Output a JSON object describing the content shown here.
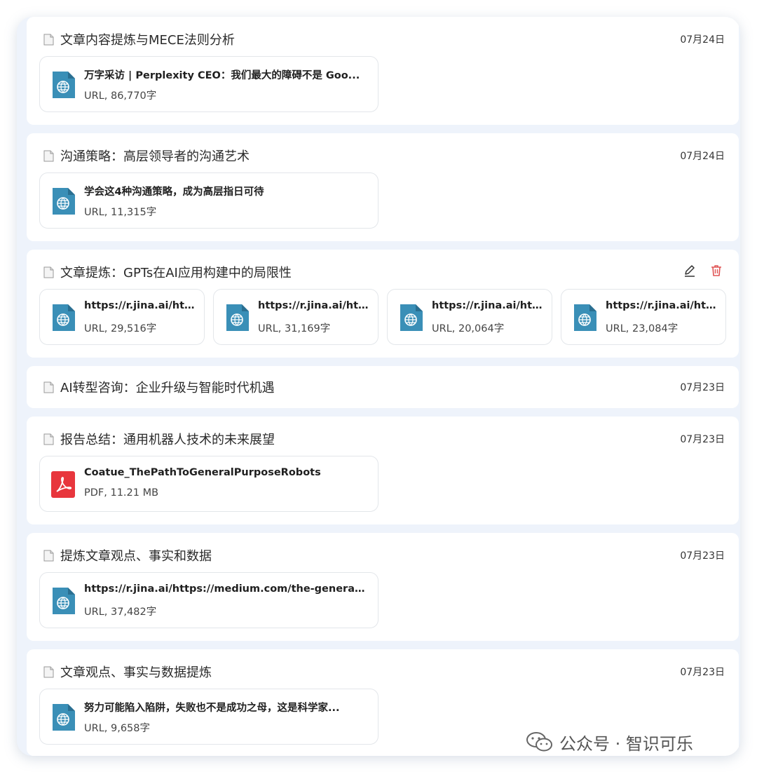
{
  "cards": [
    {
      "title": "文章内容提炼与MECE法则分析",
      "date": "07月24日",
      "attachments": [
        {
          "type": "url",
          "name": "万字采访 | Perplexity CEO：我们最大的障碍不是 Goo...",
          "meta": "URL, 86,770字"
        }
      ]
    },
    {
      "title": "沟通策略：高层领导者的沟通艺术",
      "date": "07月24日",
      "attachments": [
        {
          "type": "url",
          "name": "学会这4种沟通策略，成为高层指日可待",
          "meta": "URL, 11,315字"
        }
      ]
    },
    {
      "title": "文章提炼：GPTs在AI应用构建中的局限性",
      "date": "",
      "actions": [
        "edit-icon",
        "trash-icon"
      ],
      "attachments": [
        {
          "type": "url",
          "name": "https://r.jina.ai/htt...",
          "meta": "URL, 29,516字"
        },
        {
          "type": "url",
          "name": "https://r.jina.ai/htt...",
          "meta": "URL, 31,169字"
        },
        {
          "type": "url",
          "name": "https://r.jina.ai/htt...",
          "meta": "URL, 20,064字"
        },
        {
          "type": "url",
          "name": "https://r.jina.ai/htt...",
          "meta": "URL, 23,084字"
        }
      ]
    },
    {
      "title": "AI转型咨询：企业升级与智能时代机遇",
      "date": "07月23日",
      "attachments": []
    },
    {
      "title": "报告总结：通用机器人技术的未来展望",
      "date": "07月23日",
      "attachments": [
        {
          "type": "pdf",
          "name": "Coatue_ThePathToGeneralPurposeRobots",
          "meta": "PDF, 11.21 MB"
        }
      ]
    },
    {
      "title": "提炼文章观点、事实和数据",
      "date": "07月23日",
      "attachments": [
        {
          "type": "url",
          "name": "https://r.jina.ai/https://medium.com/the-generato...",
          "meta": "URL, 37,482字"
        }
      ]
    },
    {
      "title": "文章观点、事实与数据提炼",
      "date": "07月23日",
      "attachments": [
        {
          "type": "url",
          "name": "努力可能陷入陷阱，失败也不是成功之母，这是科学家...",
          "meta": "URL, 9,658字"
        }
      ]
    }
  ],
  "watermark": {
    "text": "公众号 · 智识可乐",
    "icon": "wechat-icon"
  },
  "colors": {
    "url_icon": "#3a8fb7",
    "pdf_icon": "#e8363d",
    "trash": "#e05555"
  }
}
